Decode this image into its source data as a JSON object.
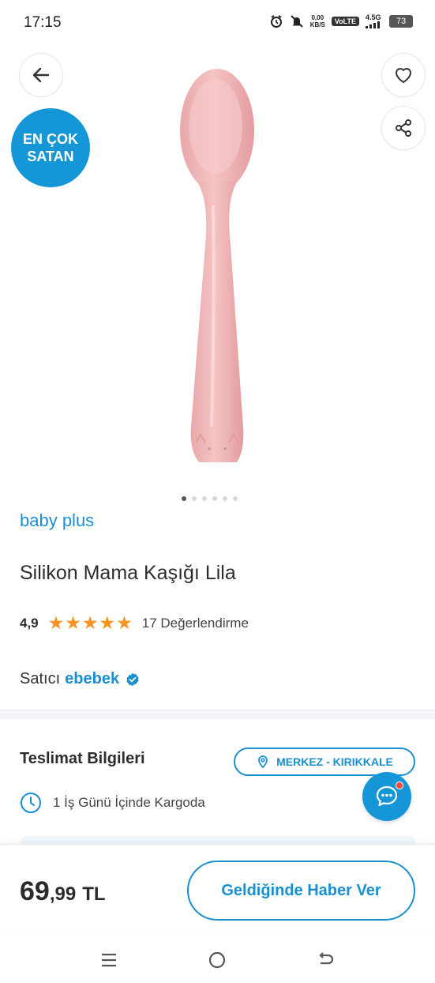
{
  "status_bar": {
    "time": "17:15",
    "speed_value": "0,00",
    "speed_unit": "KB/S",
    "volte": "VoLTE",
    "network": "4.5G",
    "battery": "73"
  },
  "product_image": {
    "badge_line1": "EN ÇOK",
    "badge_line2": "SATAN",
    "dots_count": 6,
    "active_dot": 0
  },
  "product": {
    "brand": "baby plus",
    "title": "Silikon Mama Kaşığı Lila",
    "rating": "4,9",
    "stars": 5,
    "review_count": "17 Değerlendirme",
    "seller_prefix": "Satıcı",
    "seller_name": "ebebek"
  },
  "delivery": {
    "title": "Teslimat Bilgileri",
    "location": "MERKEZ - KIRIKKALE",
    "info": "1 İş Günü İçinde Kargoda"
  },
  "bottom_bar": {
    "price_main": "69",
    "price_frac": ",99",
    "currency": "TL",
    "notify_label": "Geldiğinde Haber Ver"
  },
  "icons": {
    "back": "arrow-left-icon",
    "favorite": "heart-icon",
    "share": "share-icon",
    "location": "map-pin-icon",
    "clock": "clock-icon",
    "chat": "chat-icon",
    "verified": "verified-check-icon"
  },
  "colors": {
    "accent": "#1a8fd0",
    "badge": "#1596d6",
    "star": "#f7931e",
    "spoon": "#f2b8b8"
  }
}
